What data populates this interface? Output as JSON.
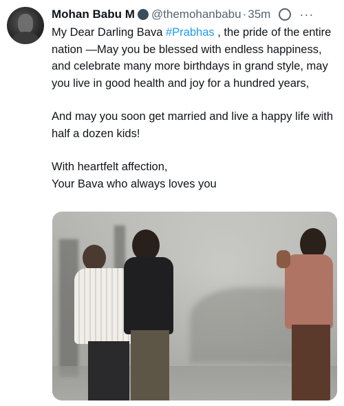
{
  "tweet": {
    "author_name": "Mohan Babu M",
    "handle": "@themohanbabu",
    "separator": "·",
    "time": "35m",
    "more_label": "···",
    "text": {
      "line1_before": "My Dear Darling Bava ",
      "hashtag": "#Prabhas",
      "line1_after": " , the pride of the entire nation —May you be blessed with endless happiness, and  celebrate many more birthdays in grand style, may you live in good health and joy for a hundred years,",
      "para2": "And may you soon get married and live a happy life with half a dozen kids!",
      "para3_line1": "With heartfelt affection,",
      "para3_line2": "Your Bava who always loves you"
    }
  },
  "icons": {
    "avatar": "profile-photo",
    "verified": "verified-badge-icon",
    "grok": "grok-icon",
    "more": "more-options-icon"
  },
  "colors": {
    "text": "#0f1419",
    "secondary": "#536471",
    "hashtag": "#1d9bf0",
    "verified_badge": "#3a4d5c"
  }
}
